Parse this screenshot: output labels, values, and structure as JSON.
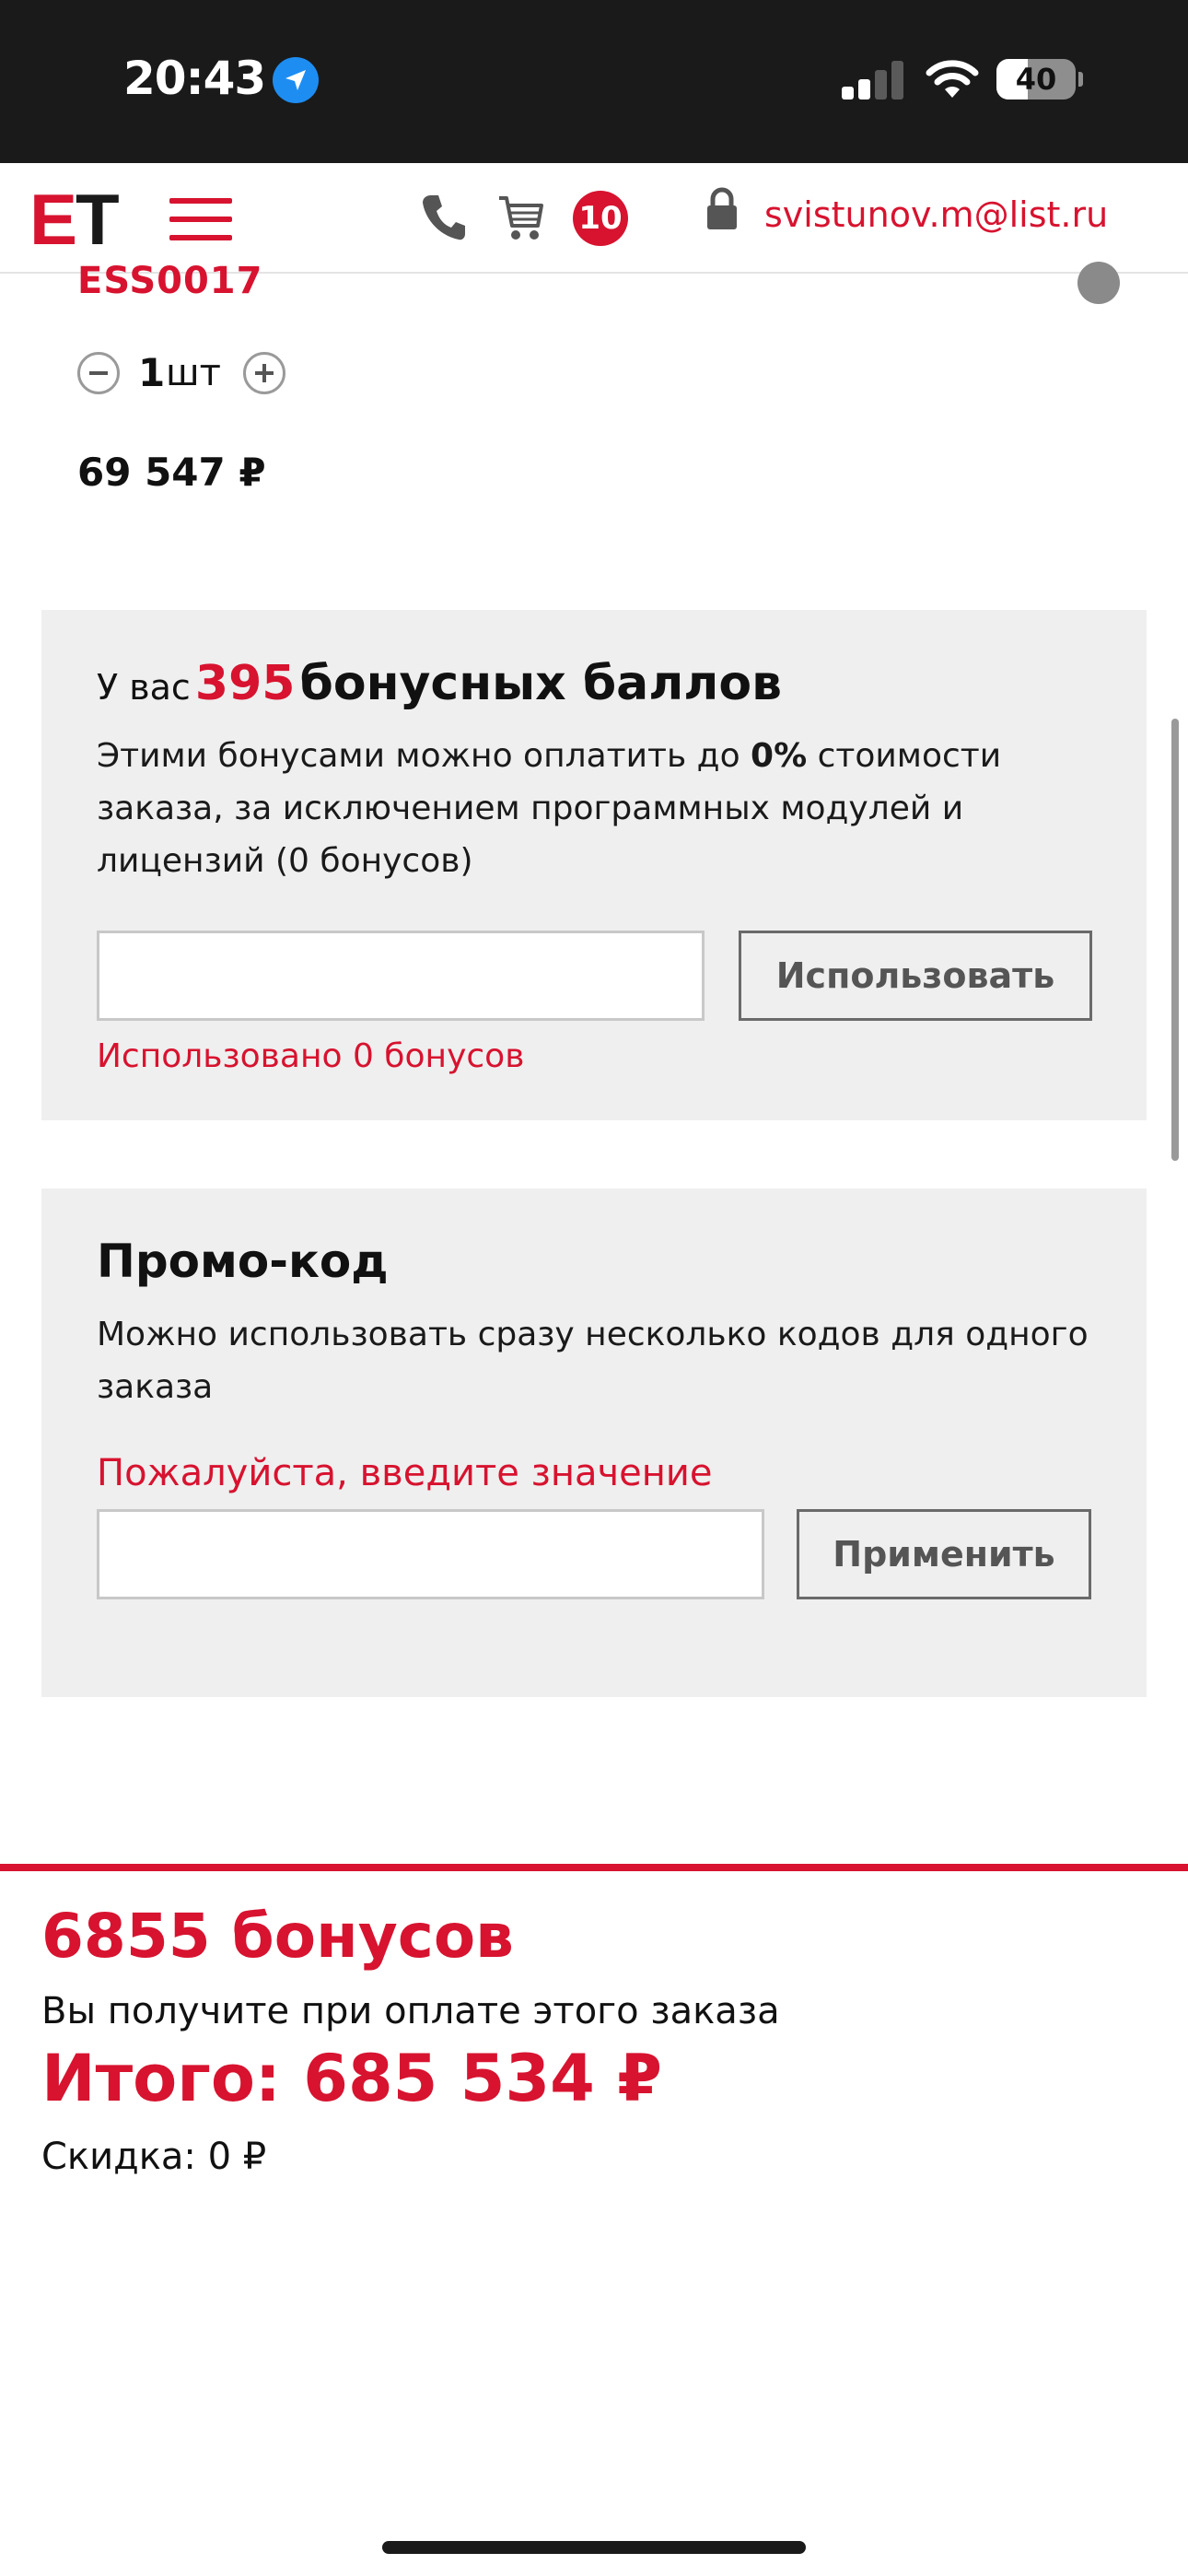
{
  "status_bar": {
    "time": "20:43",
    "battery_level": "40",
    "icons": [
      "location-arrow-icon",
      "signal-icon",
      "wifi-icon",
      "battery-icon"
    ]
  },
  "header": {
    "logo_part1": "E",
    "logo_part2": "T",
    "cart_count": "10",
    "user_email": "svistunov.m@list.ru",
    "icons": [
      "menu-icon",
      "phone-icon",
      "cart-icon",
      "lock-icon"
    ]
  },
  "cart_item": {
    "code": "ESS0017",
    "quantity": "1",
    "unit": "шт",
    "price": "69 547 ₽"
  },
  "bonus": {
    "prefix": "У вас",
    "points": "395",
    "suffix": "бонусных баллов",
    "desc_part1": "Этими бонусами можно оплатить до",
    "desc_percent": "0%",
    "desc_part2": "стоимости заказа, за исключением программных модулей и лицензий (0 бонусов)",
    "input_value": "",
    "apply_label": "Использовать",
    "used_text": "Использовано 0 бонусов"
  },
  "promo": {
    "title": "Промо-код",
    "description": "Можно использовать сразу несколько кодов для одного заказа",
    "error": "Пожалуйста, введите значение",
    "input_value": "",
    "apply_label": "Применить"
  },
  "totals": {
    "bonus_earn": "6855 бонусов",
    "bonus_note": "Вы получите при оплате этого заказа",
    "total": "Итого: 685 534 ₽",
    "discount": "Скидка: 0 ₽"
  },
  "colors": {
    "accent": "#d7132f",
    "panel_bg": "#efefef",
    "status_bar_bg": "#1a1a1a"
  }
}
